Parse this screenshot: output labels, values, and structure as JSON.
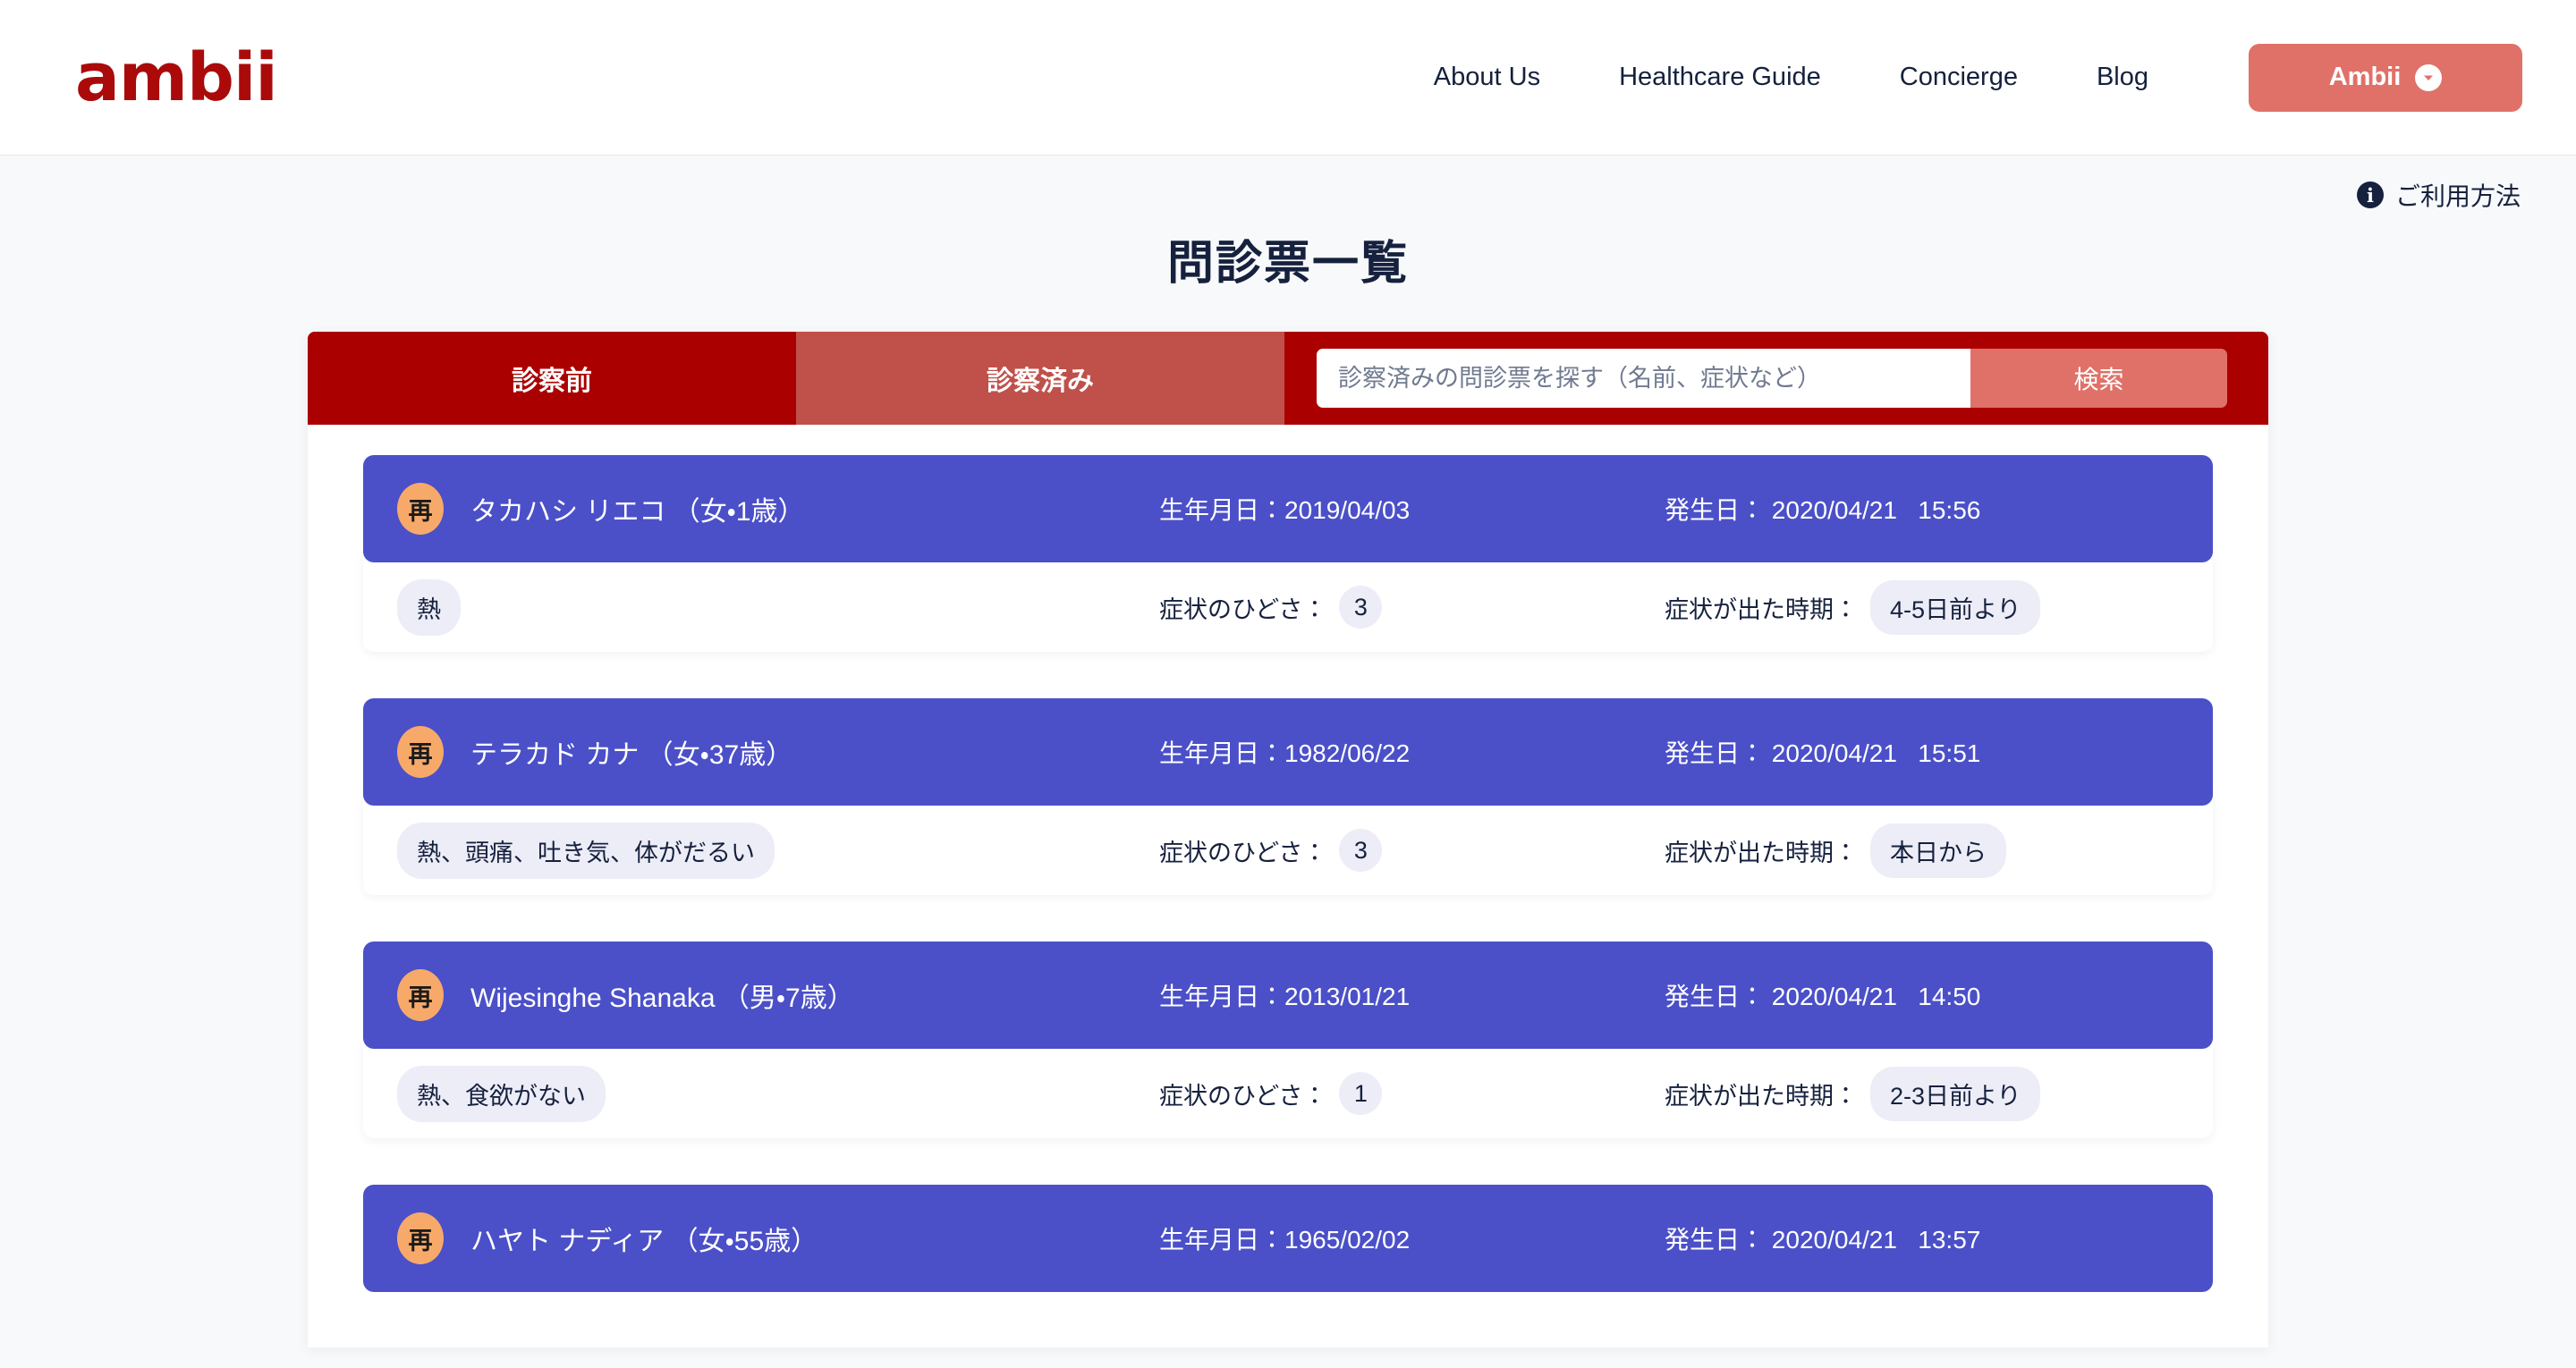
{
  "header": {
    "logo": "ambii",
    "nav": [
      {
        "label": "About Us"
      },
      {
        "label": "Healthcare Guide"
      },
      {
        "label": "Concierge"
      },
      {
        "label": "Blog"
      }
    ],
    "account_button": {
      "label": "Ambii",
      "icon": "chevron-down-circle-icon"
    }
  },
  "help": {
    "icon": "info-icon",
    "icon_glyph": "i",
    "label": "ご利用方法"
  },
  "page_title": "問診票一覧",
  "tabs": [
    {
      "label": "診察前",
      "active": true
    },
    {
      "label": "診察済み",
      "active": false
    }
  ],
  "search": {
    "placeholder": "診察済みの問診票を探す（名前、症状など）",
    "value": "",
    "button_label": "検索"
  },
  "labels": {
    "birth": "生年月日：",
    "onset": "発生日：",
    "severity": "症状のひどさ：",
    "since": "症状が出た時期："
  },
  "colors": {
    "brand_red": "#ab0000",
    "logo_red": "#ab0a0a",
    "accent_coral": "#e07168",
    "card_purple": "#4b50c8",
    "badge_orange": "#f7a96a",
    "pill_lavender": "#ecedf7",
    "page_bg": "#f8f9fb",
    "text_navy": "#16213e"
  },
  "cards": [
    {
      "badge": "再",
      "name": "タカハシ リエコ （女・1歳）",
      "birth_date": "2019/04/03",
      "onset_date": "2020/04/21",
      "onset_time": "15:56",
      "symptoms": "熱",
      "severity": "3",
      "since": "4-5日前より"
    },
    {
      "badge": "再",
      "name": "テラカド カナ （女・37歳）",
      "birth_date": "1982/06/22",
      "onset_date": "2020/04/21",
      "onset_time": "15:51",
      "symptoms": "熱、頭痛、吐き気、体がだるい",
      "severity": "3",
      "since": "本日から"
    },
    {
      "badge": "再",
      "name": "Wijesinghe Shanaka （男・7歳）",
      "birth_date": "2013/01/21",
      "onset_date": "2020/04/21",
      "onset_time": "14:50",
      "symptoms": "熱、食欲がない",
      "severity": "1",
      "since": "2-3日前より"
    },
    {
      "badge": "再",
      "name": "ハヤト ナディア （女・55歳）",
      "birth_date": "1965/02/02",
      "onset_date": "2020/04/21",
      "onset_time": "13:57",
      "symptoms": "",
      "severity": "",
      "since": ""
    }
  ]
}
